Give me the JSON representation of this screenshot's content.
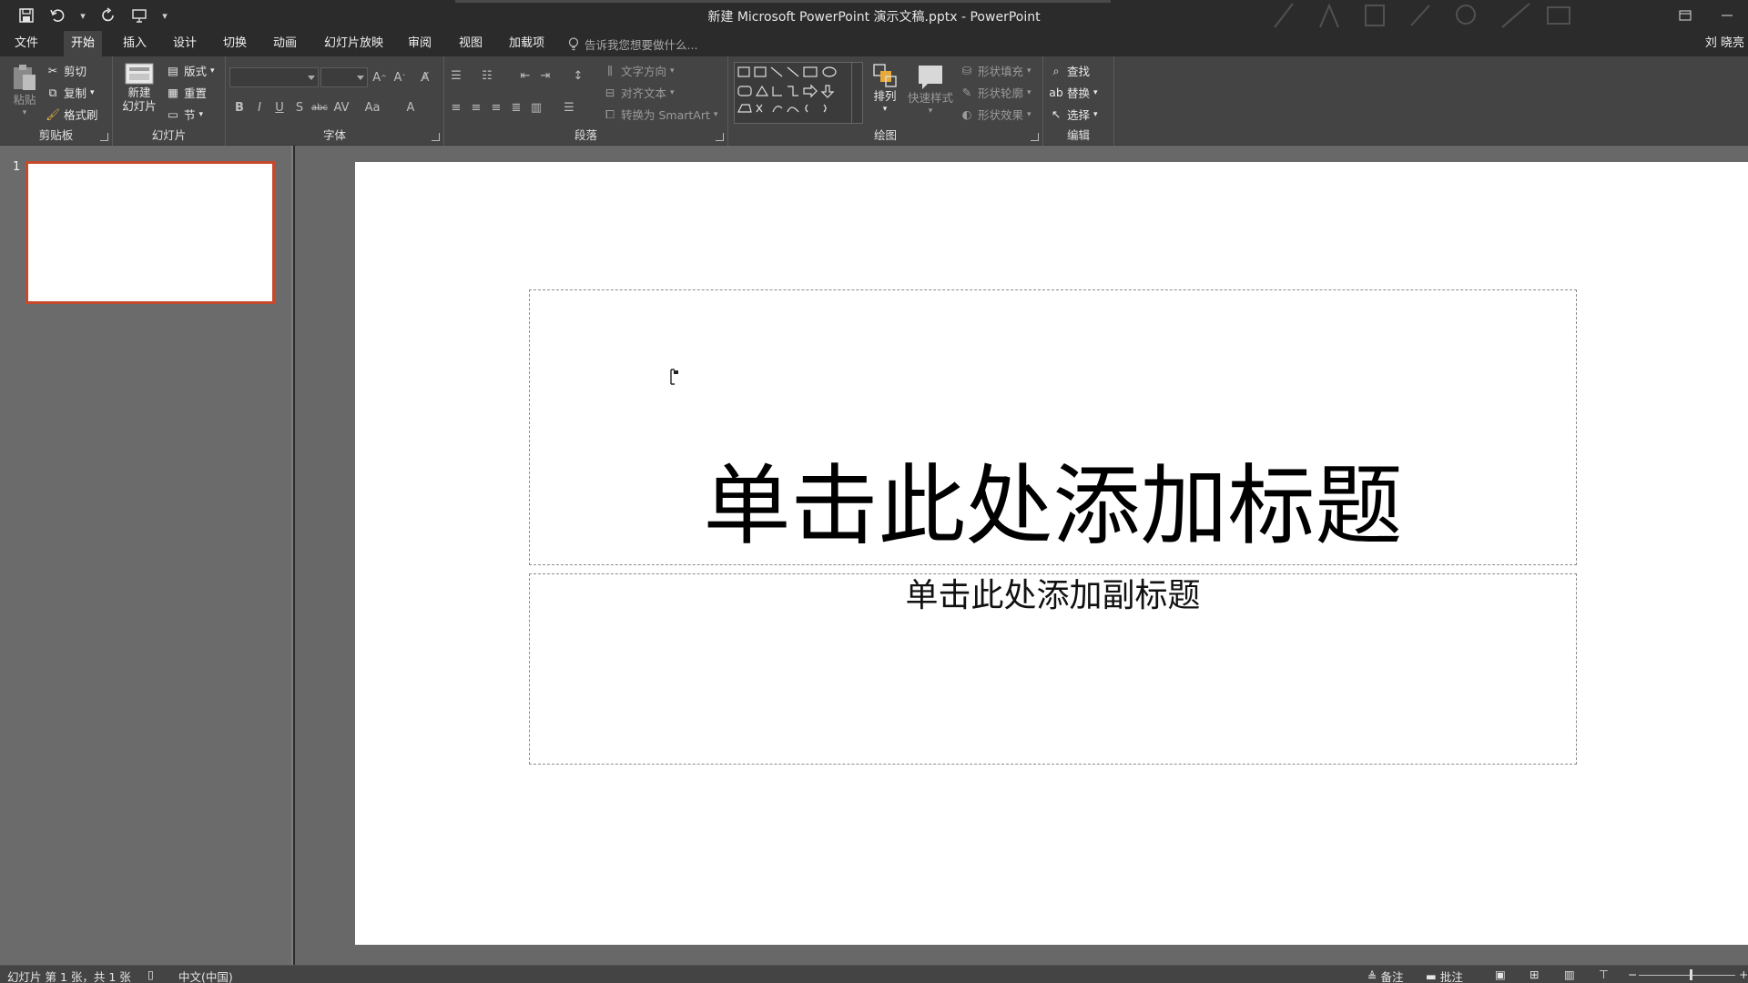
{
  "window": {
    "title": "新建 Microsoft PowerPoint 演示文稿.pptx - PowerPoint"
  },
  "tabs": [
    {
      "label": "文件"
    },
    {
      "label": "开始"
    },
    {
      "label": "插入"
    },
    {
      "label": "设计"
    },
    {
      "label": "切换"
    },
    {
      "label": "动画"
    },
    {
      "label": "幻灯片放映"
    },
    {
      "label": "审阅"
    },
    {
      "label": "视图"
    },
    {
      "label": "加载项"
    }
  ],
  "active_tab": "开始",
  "tell_me": {
    "placeholder": "告诉我您想要做什么..."
  },
  "user": {
    "name": "刘 晓亮"
  },
  "ribbon": {
    "clipboard": {
      "label": "剪贴板",
      "paste": "粘贴",
      "cut": "剪切",
      "copy": "复制",
      "format_painter": "格式刷"
    },
    "slides": {
      "label": "幻灯片",
      "new_slide_1": "新建",
      "new_slide_2": "幻灯片",
      "layout": "版式",
      "reset": "重置",
      "section": "节"
    },
    "font": {
      "label": "字体",
      "bold": "B",
      "italic": "I",
      "underline": "U",
      "shadow": "S",
      "strike": "abc",
      "case": "Aa"
    },
    "paragraph": {
      "label": "段落",
      "text_direction": "文字方向",
      "align_text": "对齐文本",
      "smartart": "转换为 SmartArt"
    },
    "drawing": {
      "label": "绘图",
      "arrange": "排列",
      "quick_styles": "快速样式",
      "shape_fill": "形状填充",
      "shape_outline": "形状轮廓",
      "shape_effects": "形状效果"
    },
    "editing": {
      "label": "编辑",
      "find": "查找",
      "replace": "替换",
      "select": "选择"
    }
  },
  "thumbnails": [
    {
      "number": "1"
    }
  ],
  "slide": {
    "title_placeholder": "单击此处添加标题",
    "subtitle_placeholder": "单击此处添加副标题"
  },
  "status": {
    "slide_info": "幻灯片 第 1 张，共 1 张",
    "language": "中文(中国)",
    "notes": "备注",
    "comments": "批注"
  },
  "colors": {
    "accent_selection": "#c54a2c",
    "titlebar": "#2b2b2b",
    "ribbon": "#444444",
    "pane": "#6b6b6b"
  }
}
